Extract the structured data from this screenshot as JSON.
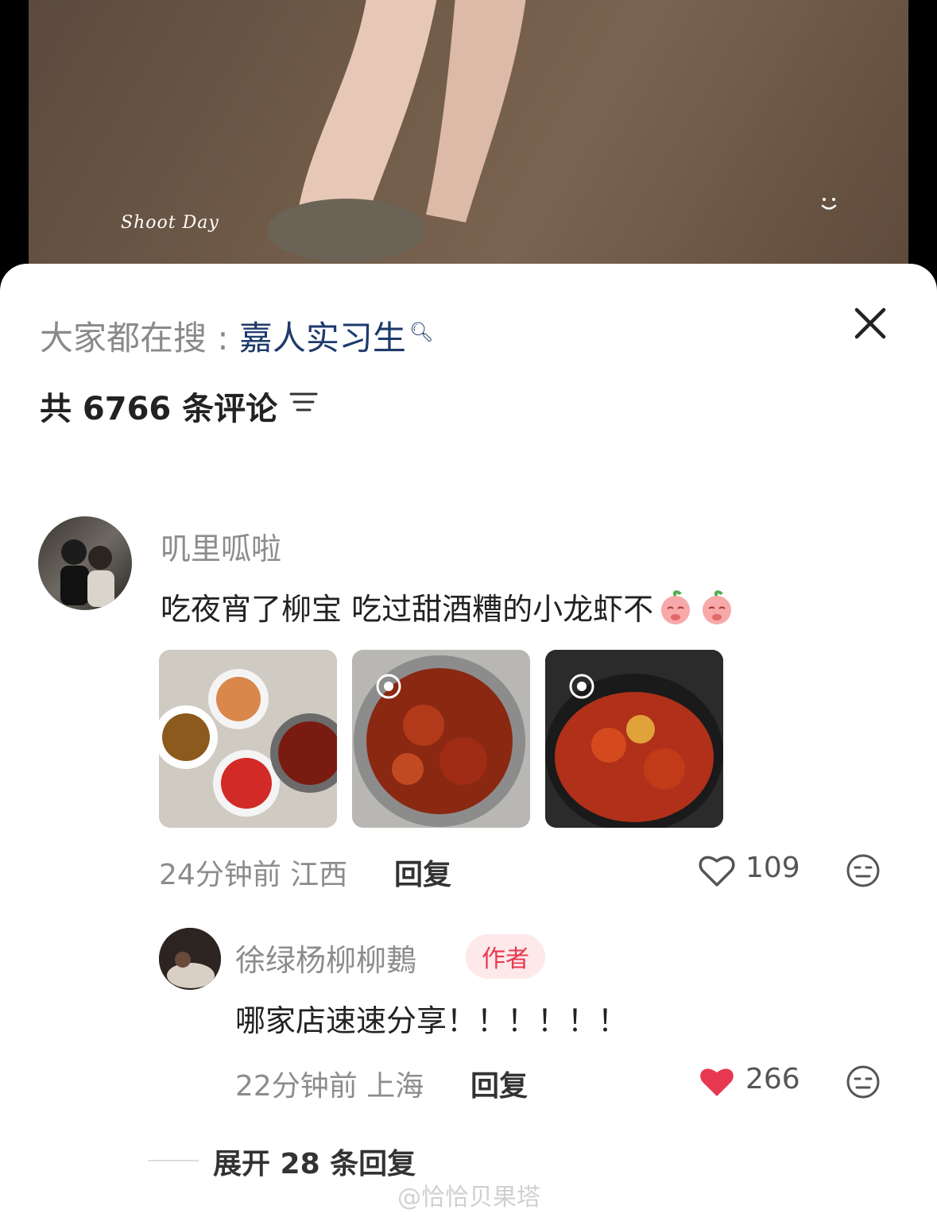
{
  "video": {
    "caption": "Shoot Day"
  },
  "search_hint": {
    "prefix": "大家都在搜 : ",
    "keyword": "嘉人实习生"
  },
  "comments_header": {
    "count_text": "共 6766 条评论"
  },
  "comment": {
    "username": "叽里呱啦",
    "text": "吃夜宵了柳宝 吃过甜酒糟的小龙虾不",
    "time": "24分钟前",
    "location": "江西",
    "reply_label": "回复",
    "likes": "109"
  },
  "reply": {
    "username": "徐绿杨柳柳鶈",
    "badge": "作者",
    "text": "哪家店速速分享！！！！！！",
    "time": "22分钟前",
    "location": "上海",
    "reply_label": "回复",
    "likes": "266"
  },
  "expand_label": "展开 28 条回复",
  "watermark": "@恰恰贝果塔",
  "colors": {
    "liked": "#e8384f",
    "keyword": "#1e3a6b",
    "badge_bg": "#fde8ea"
  }
}
